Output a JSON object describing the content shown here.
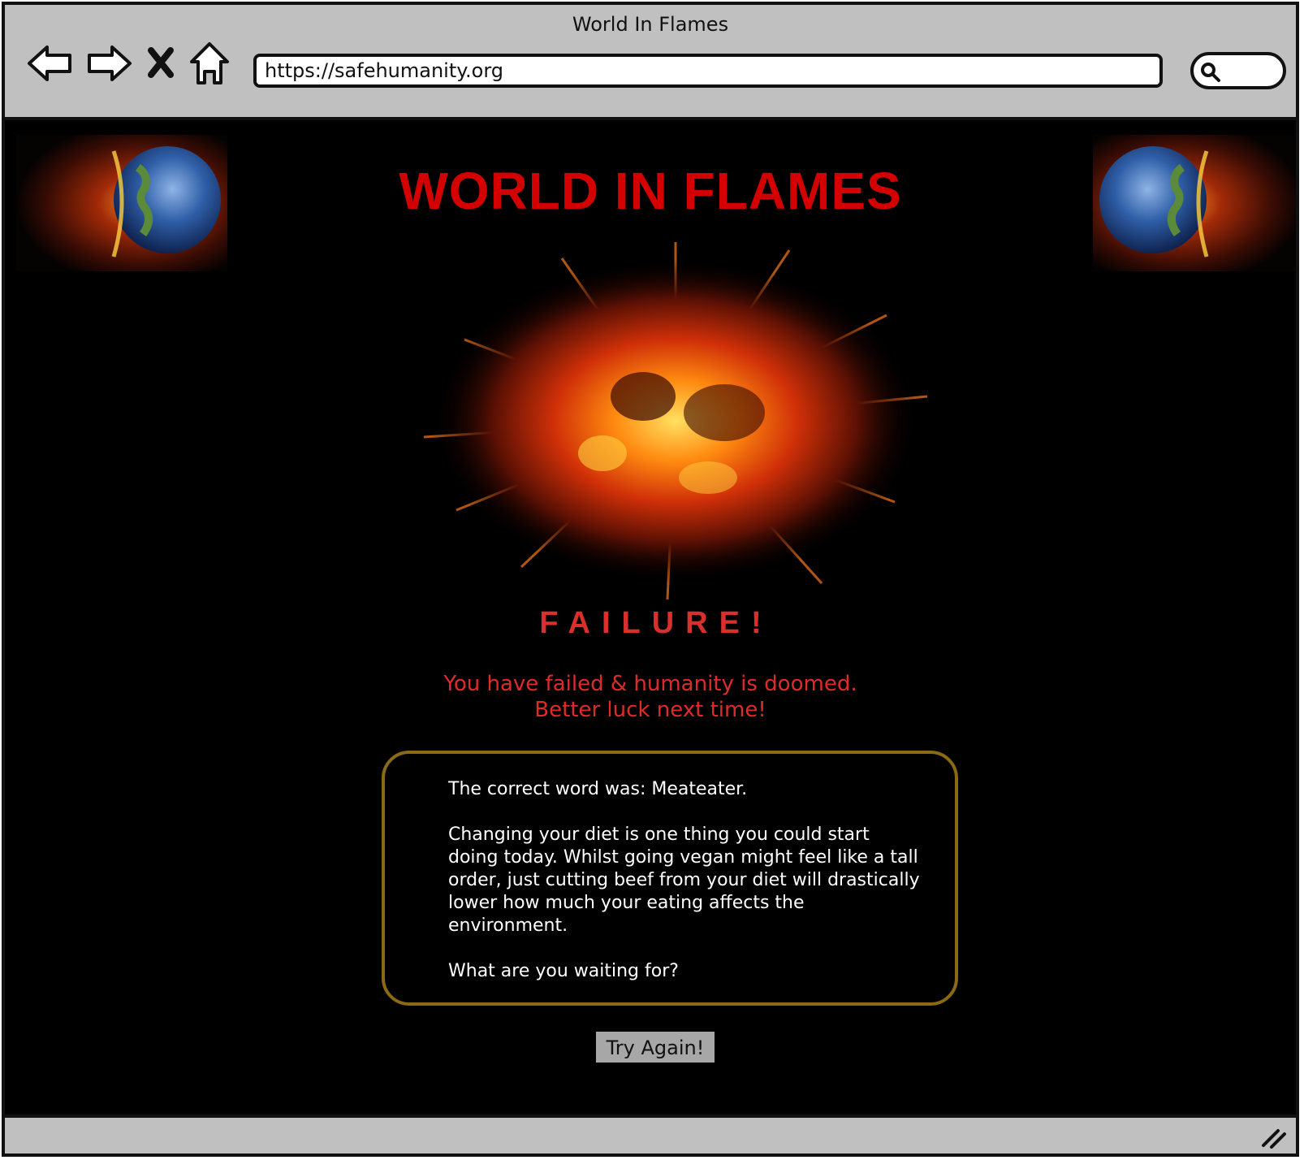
{
  "window": {
    "title": "World In Flames"
  },
  "toolbar": {
    "back_icon": "back-arrow-icon",
    "forward_icon": "forward-arrow-icon",
    "stop_icon": "close-icon",
    "home_icon": "home-icon",
    "url": "https://safehumanity.org",
    "search_icon": "search-icon"
  },
  "page": {
    "headline": "WORLD IN FLAMES",
    "failure_title": "FAILURE!",
    "message_line1": "You have failed & humanity is doomed.",
    "message_line2": "Better luck next time!",
    "info": {
      "correct_word": "The correct word was: Meateater.",
      "advice": "Changing your diet is one thing you could start doing today. Whilst going vegan might feel like a tall order, just cutting  beef from your diet will drastically lower how much your eating affects the environment.",
      "closing": "What are you waiting for?"
    },
    "try_again_label": "Try Again!"
  },
  "colors": {
    "headline": "#d40000",
    "failure": "#d9302c",
    "message": "#e02a2a",
    "box_border": "#8a6a12",
    "chrome": "#c0c0c0",
    "button": "#a7a7a7"
  }
}
